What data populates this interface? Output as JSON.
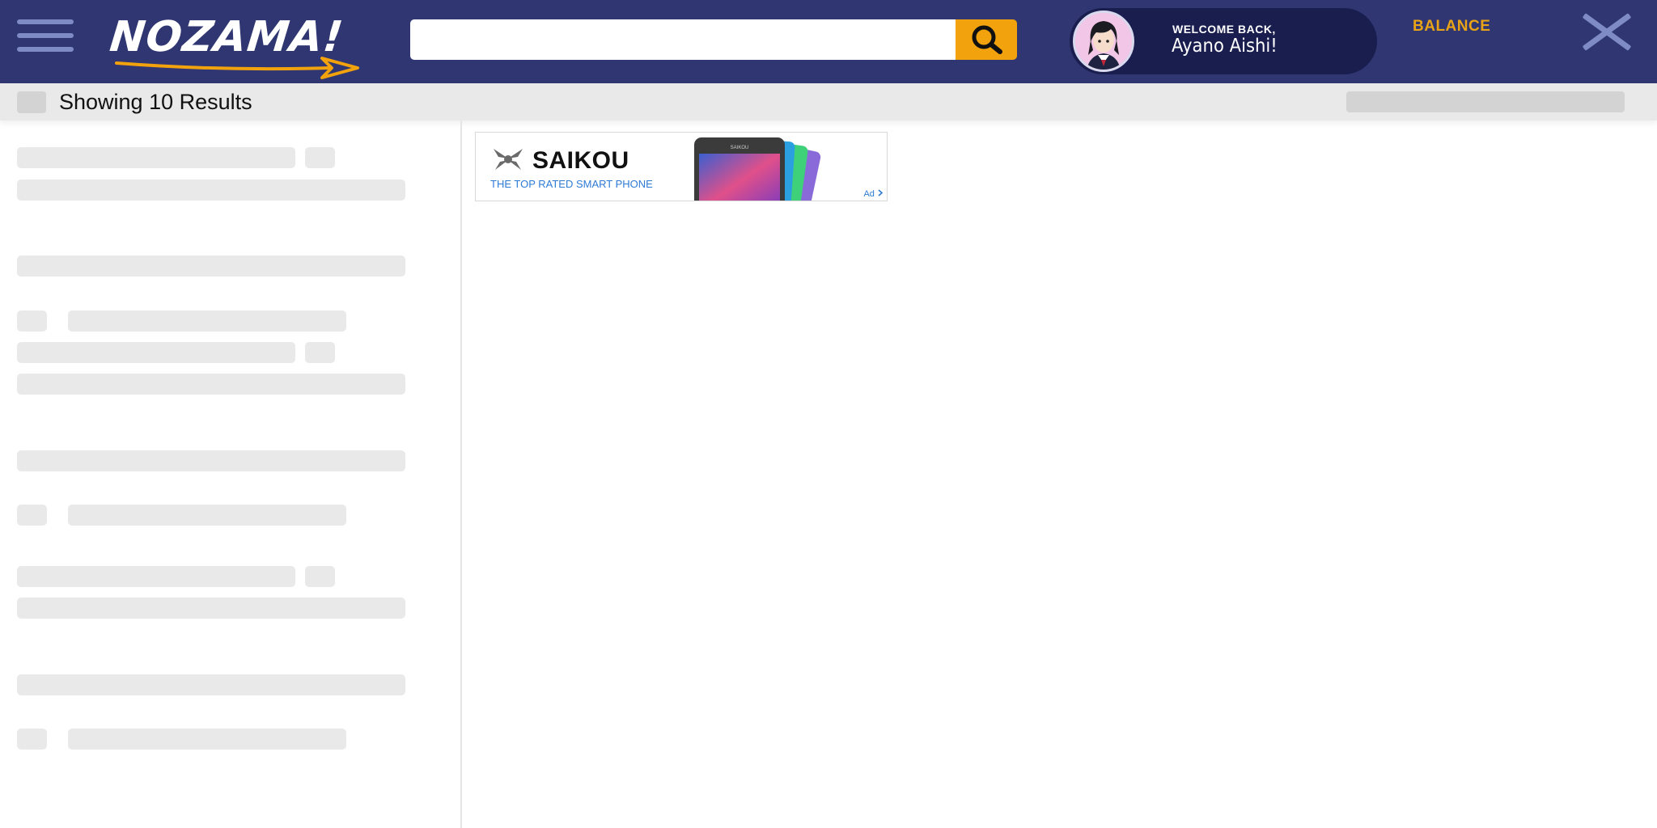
{
  "header": {
    "logo_text": "NOZAMA!",
    "search": {
      "value": "",
      "placeholder": ""
    },
    "welcome": {
      "label": "WELCOME BACK,",
      "name": "Ayano Aishi!"
    },
    "balance_label": "BALANCE"
  },
  "results": {
    "count_label": "Showing 10 Results"
  },
  "ad": {
    "brand": "SAIKOU",
    "tagline": "THE TOP RATED SMART PHONE",
    "badge": "Ad",
    "phone_screen_label": "SAIKOU"
  },
  "colors": {
    "header_bg": "#2f3671",
    "accent": "#f2a20c",
    "welcome_pill": "#1a1e4f",
    "balance": "#e8a316",
    "placeholder": "#e8e9e8",
    "ad_link": "#2e7bd6"
  },
  "icons": [
    "menu-icon",
    "search-icon",
    "close-icon",
    "avatar",
    "saikou-logo-icon",
    "ad-arrow-icon"
  ]
}
